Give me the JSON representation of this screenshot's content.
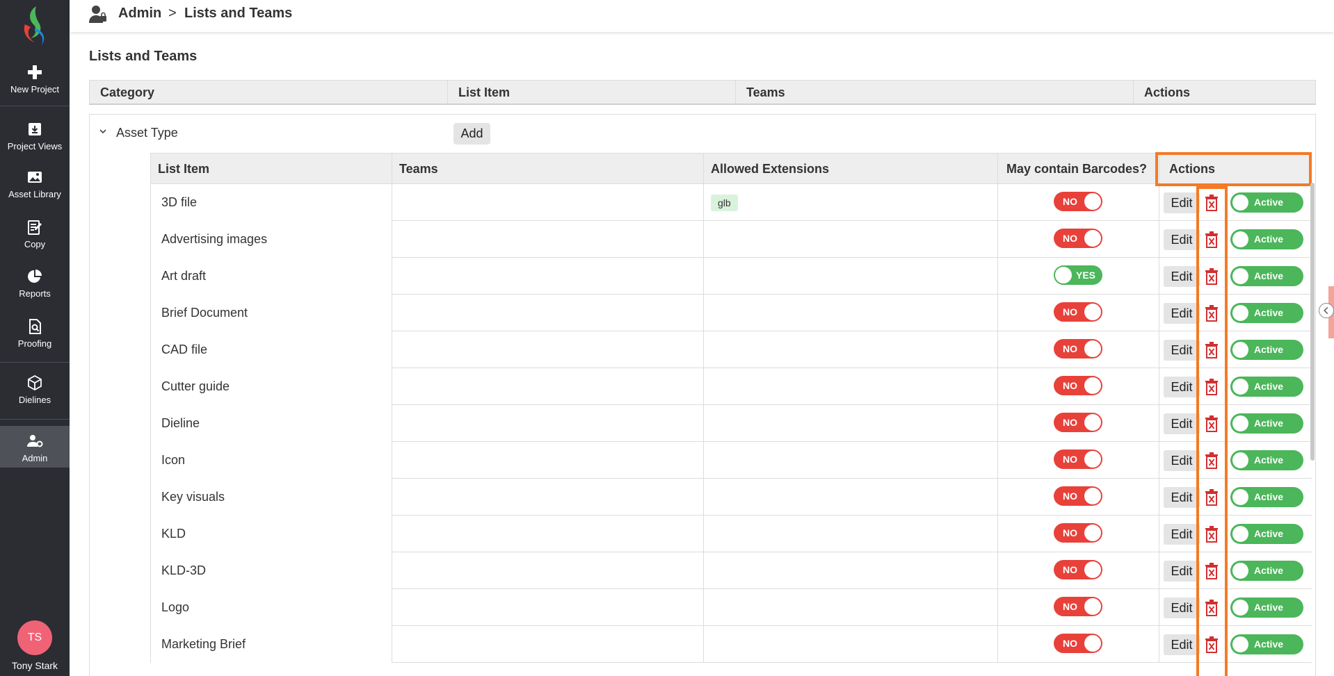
{
  "sidebar": {
    "items": [
      {
        "label": "New Project",
        "icon": "plus-icon"
      },
      {
        "label": "Project Views",
        "icon": "download-box-icon"
      },
      {
        "label": "Asset Library",
        "icon": "image-icon"
      },
      {
        "label": "Copy",
        "icon": "edit-document-icon"
      },
      {
        "label": "Reports",
        "icon": "pie-chart-icon"
      },
      {
        "label": "Proofing",
        "icon": "search-document-icon"
      },
      {
        "label": "Dielines",
        "icon": "box-icon"
      },
      {
        "label": "Admin",
        "icon": "user-gear-icon"
      }
    ],
    "user": {
      "initials": "TS",
      "name": "Tony Stark"
    }
  },
  "header": {
    "breadcrumb": {
      "section": "Admin",
      "separator": ">",
      "page": "Lists and Teams"
    }
  },
  "page_title": "Lists and Teams",
  "outer_table": {
    "columns": [
      "Category",
      "List Item",
      "Teams",
      "Actions"
    ]
  },
  "group": {
    "label": "Asset Type",
    "add_label": "Add"
  },
  "inner_table": {
    "columns": [
      "List Item",
      "Teams",
      "Allowed Extensions",
      "May contain Barcodes?",
      "Actions"
    ],
    "edit_label": "Edit",
    "status_label": "Active",
    "rows": [
      {
        "name": "3D file",
        "teams": "",
        "extension": "glb",
        "barcodes": "NO"
      },
      {
        "name": "Advertising images",
        "teams": "",
        "extension": "",
        "barcodes": "NO"
      },
      {
        "name": "Art draft",
        "teams": "",
        "extension": "",
        "barcodes": "YES"
      },
      {
        "name": "Brief Document",
        "teams": "",
        "extension": "",
        "barcodes": "NO"
      },
      {
        "name": "CAD file",
        "teams": "",
        "extension": "",
        "barcodes": "NO"
      },
      {
        "name": "Cutter guide",
        "teams": "",
        "extension": "",
        "barcodes": "NO"
      },
      {
        "name": "Dieline",
        "teams": "",
        "extension": "",
        "barcodes": "NO"
      },
      {
        "name": "Icon",
        "teams": "",
        "extension": "",
        "barcodes": "NO"
      },
      {
        "name": "Key visuals",
        "teams": "",
        "extension": "",
        "barcodes": "NO"
      },
      {
        "name": "KLD",
        "teams": "",
        "extension": "",
        "barcodes": "NO"
      },
      {
        "name": "KLD-3D",
        "teams": "",
        "extension": "",
        "barcodes": "NO"
      },
      {
        "name": "Logo",
        "teams": "",
        "extension": "",
        "barcodes": "NO"
      },
      {
        "name": "Marketing Brief",
        "teams": "",
        "extension": "",
        "barcodes": "NO"
      }
    ]
  },
  "colors": {
    "sidebar_bg": "#2b2d33",
    "toggle_no": "#e8413a",
    "toggle_yes": "#4bb65a",
    "highlight": "#f47a25",
    "delete_red": "#d32f2f",
    "avatar": "#f06276"
  }
}
